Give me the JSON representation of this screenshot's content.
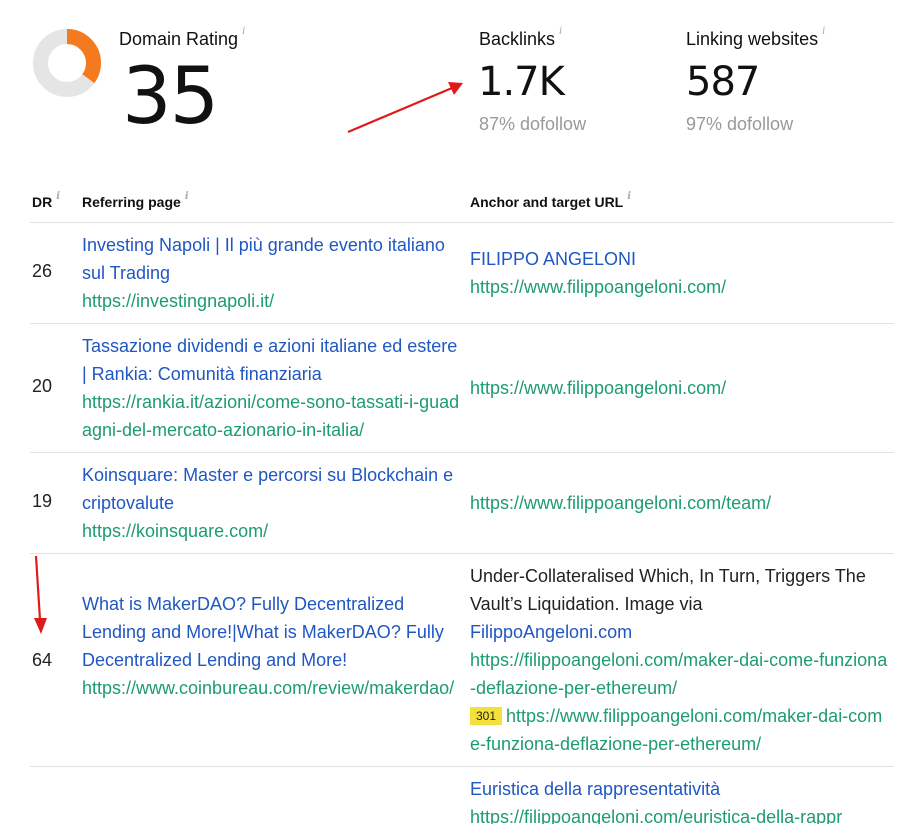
{
  "metrics": {
    "domain_rating": {
      "label": "Domain Rating",
      "value": "35",
      "fraction": 0.35
    },
    "backlinks": {
      "label": "Backlinks",
      "value": "1.7K",
      "sub": "87% dofollow"
    },
    "linking_websites": {
      "label": "Linking websites",
      "value": "587",
      "sub": "97% dofollow"
    },
    "info_glyph": "i"
  },
  "colors": {
    "donut_accent": "#f47a1f",
    "donut_track": "#e5e5e5",
    "link_blue": "#1f57c3",
    "url_green": "#1d9c70",
    "annotation_arrow": "#e0191b",
    "redirect_badge": "#f2e13a"
  },
  "table": {
    "headers": {
      "dr": "DR",
      "referring_page": "Referring page",
      "anchor": "Anchor and target URL"
    },
    "rows": [
      {
        "dr": "26",
        "ref_title": "Investing Napoli | Il più grande evento italiano sul Trading",
        "ref_url": "https://investingnapoli.it/",
        "anchor_text": "FILIPPO ANGELONI",
        "target_url": "https://www.filippoangeloni.com/"
      },
      {
        "dr": "20",
        "ref_title": "Tassazione dividendi e azioni italiane ed estere | Rankia: Comunità finanziaria",
        "ref_url": "https://rankia.it/azioni/come-sono-tassati-i-guadagni-del-mercato-azionario-in-italia/",
        "target_url": "https://www.filippoangeloni.com/"
      },
      {
        "dr": "19",
        "ref_title": "Koinsquare: Master e percorsi su Blockchain e criptovalute",
        "ref_url": "https://koinsquare.com/",
        "target_url": "https://www.filippoangeloni.com/team/"
      },
      {
        "dr": "64",
        "ref_title": "What is MakerDAO? Fully Decentralized Lending and More!|What is MakerDAO? Fully Decentralized Lending and More!",
        "ref_url": "https://www.coinbureau.com/review/makerdao/",
        "context_text": "Under-Collateralised Which, In Turn, Triggers The Vault’s Liquidation. Image via",
        "anchor_text": "FilippoAngeloni.com",
        "target_url": "https://filippoangeloni.com/maker-dai-come-funziona-deflazione-per-ethereum/",
        "redirect_code": "301",
        "redirect_url": "https://www.filippoangeloni.com/maker-dai-come-funziona-deflazione-per-ethereum/"
      },
      {
        "anchor_text": "Euristica della rappresentatività",
        "target_url": "https://filippoangeloni.com/euristica-della-rappr"
      }
    ]
  }
}
